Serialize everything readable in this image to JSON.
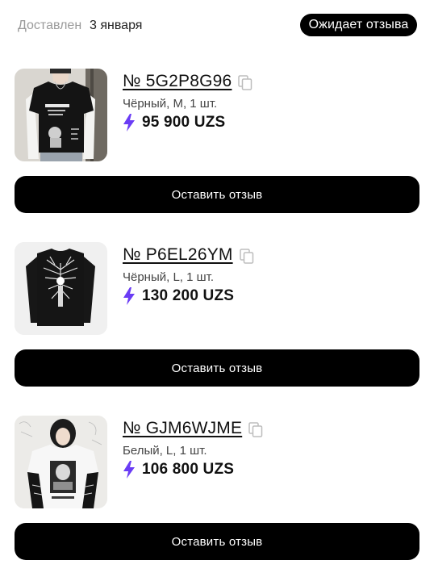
{
  "header": {
    "delivered_label": "Доставлен",
    "delivered_date": "3 января",
    "status_badge": "Ожидает отзыва"
  },
  "colors": {
    "accent_bolt": "#6a3cf5",
    "button_bg": "#000000",
    "button_text": "#ffffff"
  },
  "orders": [
    {
      "sku": "№ 5G2P8G96",
      "variant": "Чёрный, M, 1 шт.",
      "price": "95 900 UZS",
      "button_label": "Оставить отзыв",
      "image_icon": "layered-tshirt-photo"
    },
    {
      "sku": "№ P6EL26YM",
      "variant": "Чёрный, L, 1 шт.",
      "price": "130 200 UZS",
      "button_label": "Оставить отзыв",
      "image_icon": "black-graphic-longsleeve-photo"
    },
    {
      "sku": "№ GJM6WJME",
      "variant": "Белый, L, 1 шт.",
      "price": "106 800 UZS",
      "button_label": "Оставить отзыв",
      "image_icon": "white-anime-tshirt-photo"
    }
  ]
}
